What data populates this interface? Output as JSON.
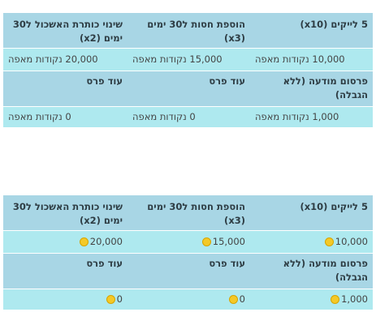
{
  "table_text": {
    "rows": [
      {
        "titles": [
          "5 לייקים (x10)",
          "הוספת חסות ל30 ימים (x3)",
          "שינוי כותרת האשכול ל30 ימים (x2)"
        ],
        "values": [
          "10,000 נקודות מאפה",
          "15,000 נקודות מאפה",
          "20,000 נקודות מאפה"
        ]
      },
      {
        "titles": [
          "פרסום מודעה (ללא הגבלה)",
          "עוד פרס",
          "עוד פרס"
        ],
        "values": [
          "1,000 נקודות מאפה",
          "0 נקודות מאפה",
          "0 נקודות מאפה"
        ]
      }
    ]
  },
  "table_coin": {
    "rows": [
      {
        "titles": [
          "5 לייקים (x10)",
          "הוספת חסות ל30 ימים (x3)",
          "שינוי כותרת האשכול ל30 ימים (x2)"
        ],
        "values": [
          "10,000",
          "15,000",
          "20,000"
        ]
      },
      {
        "titles": [
          "פרסום מודעה (ללא הגבלה)",
          "עוד פרס",
          "עוד פרס"
        ],
        "values": [
          "1,000",
          "0",
          "0"
        ]
      }
    ]
  },
  "icons": {
    "currency": "coin-icon"
  },
  "colors": {
    "header_bg": "#a8d6e5",
    "value_bg": "#aee9ef",
    "coin": "#f4c927"
  }
}
